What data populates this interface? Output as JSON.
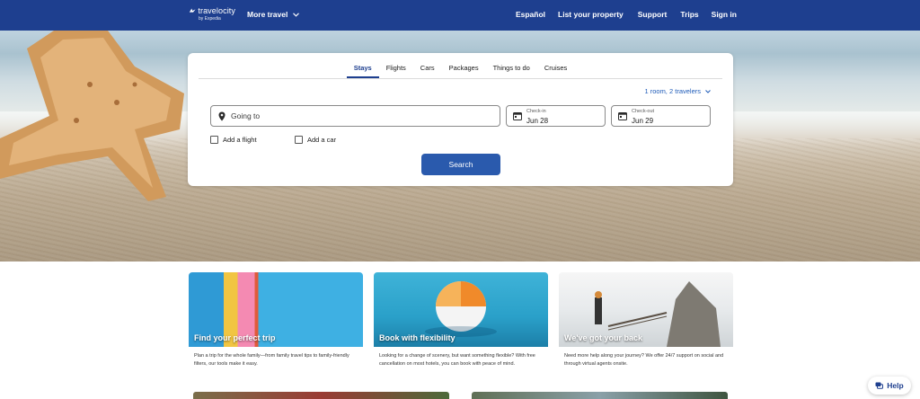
{
  "header": {
    "logo_text": "travelocity",
    "logo_sub": "by Expedia",
    "more_travel": "More travel",
    "nav": {
      "espanol": "Español",
      "list_property": "List your property",
      "support": "Support",
      "trips": "Trips",
      "sign_in": "Sign in"
    }
  },
  "search": {
    "tabs": [
      "Stays",
      "Flights",
      "Cars",
      "Packages",
      "Things to do",
      "Cruises"
    ],
    "active_tab": "Stays",
    "travelers": "1 room, 2 travelers",
    "going_to_placeholder": "Going to",
    "checkin_label": "Check-in",
    "checkin_value": "Jun 28",
    "checkout_label": "Check-out",
    "checkout_value": "Jun 29",
    "add_flight": "Add a flight",
    "add_car": "Add a car",
    "search_button": "Search"
  },
  "cards": [
    {
      "title": "Find your perfect trip",
      "desc": "Plan a trip for the whole family—from family travel tips to family-friendly filters, our tools make it easy."
    },
    {
      "title": "Book with flexibility",
      "desc": "Looking for a change of scenery, but want something flexible? With free cancellation on most hotels, you can book with peace of mind."
    },
    {
      "title": "We've got your back",
      "desc": "Need more help along your journey? We offer 24/7 support on social and through virtual agents onsite."
    }
  ],
  "help_label": "Help",
  "colors": {
    "brand_blue": "#1e3f8f",
    "button_blue": "#2a5aad",
    "link_blue": "#1e5bb8"
  }
}
